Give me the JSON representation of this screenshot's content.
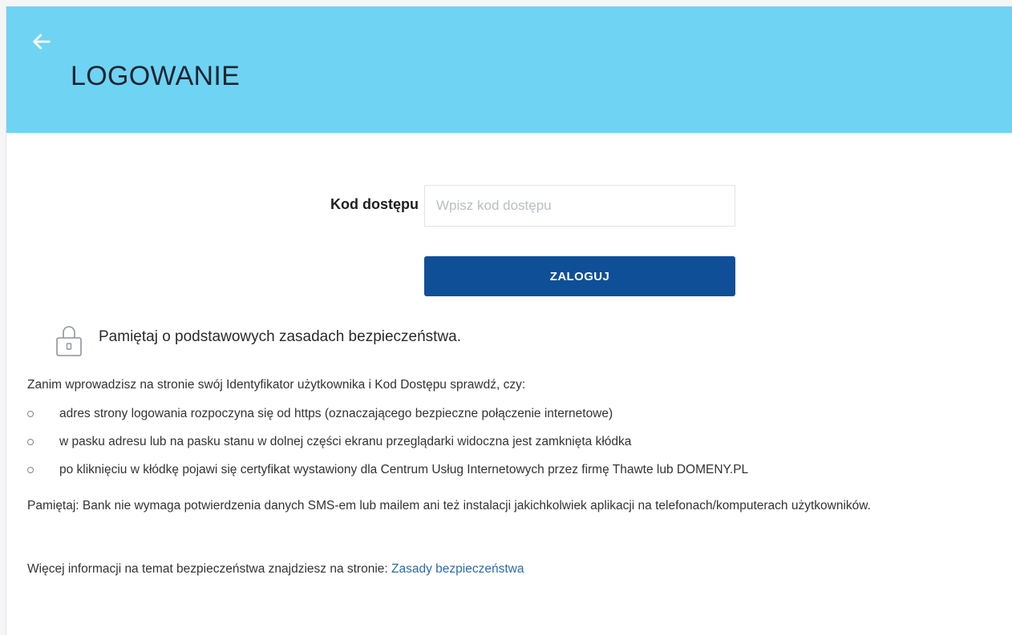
{
  "header": {
    "title": "LOGOWANIE",
    "back_icon": "arrow-left-icon",
    "background_color": "#6fd3f4"
  },
  "login_form": {
    "code_label": "Kod dostępu",
    "code_placeholder": "Wpisz kod dostępu",
    "code_value": "",
    "submit_label": "ZALOGUJ",
    "submit_color": "#0f4f97"
  },
  "security": {
    "icon": "lock-icon",
    "heading": "Pamiętaj o podstawowych zasadach bezpieczeństwa.",
    "intro": "Zanim wprowadzisz na stronie swój Identyfikator użytkownika i Kod Dostępu sprawdź, czy:",
    "checklist": [
      "adres strony logowania rozpoczyna się od https (oznaczającego bezpieczne połączenie internetowe)",
      "w pasku adresu lub na pasku stanu w dolnej części ekranu przeglądarki widoczna jest zamknięta kłódka",
      "po kliknięciu w kłódkę pojawi się certyfikat wystawiony dla Centrum Usług Internetowych przez firmę Thawte lub DOMENY.PL"
    ],
    "note": "Pamiętaj: Bank nie wymaga potwierdzenia danych SMS-em lub mailem ani też instalacji jakichkolwiek aplikacji na telefonach/komputerach użytkowników.",
    "more_info_text": "Więcej informacji na temat bezpieczeństwa znajdziesz na stronie: ",
    "more_info_link": "Zasady bezpieczeństwa",
    "link_color": "#2d6aae"
  }
}
